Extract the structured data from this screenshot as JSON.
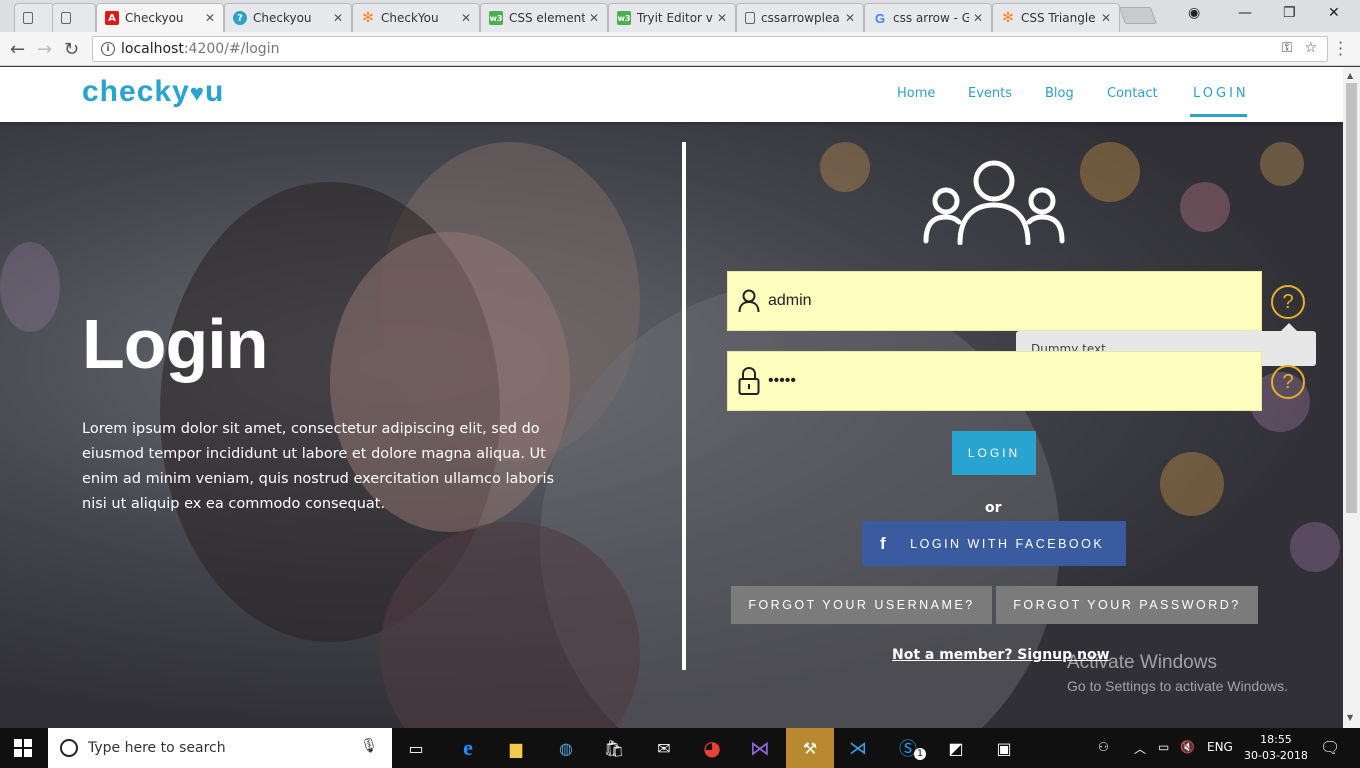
{
  "browser": {
    "tabs": [
      {
        "label": "",
        "icon": "page-icon"
      },
      {
        "label": "",
        "icon": "page-icon"
      },
      {
        "label": "Checkyou",
        "icon": "angular-icon",
        "active": true
      },
      {
        "label": "Checkyou",
        "icon": "globe-icon"
      },
      {
        "label": "CheckYou",
        "icon": "star-icon"
      },
      {
        "label": "CSS element",
        "icon": "w3-icon"
      },
      {
        "label": "Tryit Editor v",
        "icon": "w3-icon"
      },
      {
        "label": "cssarrowplea",
        "icon": "page-icon"
      },
      {
        "label": "css arrow - G",
        "icon": "google-icon"
      },
      {
        "label": "CSS Triangle",
        "icon": "star-icon"
      }
    ],
    "address": {
      "host": "localhost",
      "path": ":4200/#/login"
    }
  },
  "site": {
    "logo_text": "checky",
    "logo_tail": "u",
    "nav": {
      "home": "Home",
      "events": "Events",
      "blog": "Blog",
      "contact": "Contact",
      "login": "LOGIN"
    }
  },
  "hero": {
    "title": "Login",
    "description": "Lorem ipsum dolor sit amet, consectetur adipiscing elit, sed do eiusmod tempor incididunt ut labore et dolore magna aliqua. Ut enim ad minim veniam, quis nostrud exercitation ullamco laboris nisi ut aliquip ex ea commodo consequat."
  },
  "form": {
    "username_value": "admin",
    "password_value": "•••••",
    "help_glyph": "?",
    "tooltip": "Dummy text",
    "login_button": "LOGIN",
    "or": "or",
    "facebook_button": "LOGIN WITH FACEBOOK",
    "facebook_glyph": "f",
    "forgot_username": "FORGOT YOUR USERNAME?",
    "forgot_password": "FORGOT YOUR PASSWORD?",
    "not_member": "Not a member? Signup now"
  },
  "watermark": {
    "line1": "Activate Windows",
    "line2": "Go to Settings to activate Windows."
  },
  "taskbar": {
    "search_placeholder": "Type here to search",
    "language": "ENG",
    "time": "18:55",
    "date": "30-03-2018",
    "skype_badge": "1"
  },
  "colors": {
    "brand": "#29a3cf",
    "facebook": "#3b5ba0",
    "field_bg": "#fdfdbd",
    "help": "#e2b22a"
  }
}
